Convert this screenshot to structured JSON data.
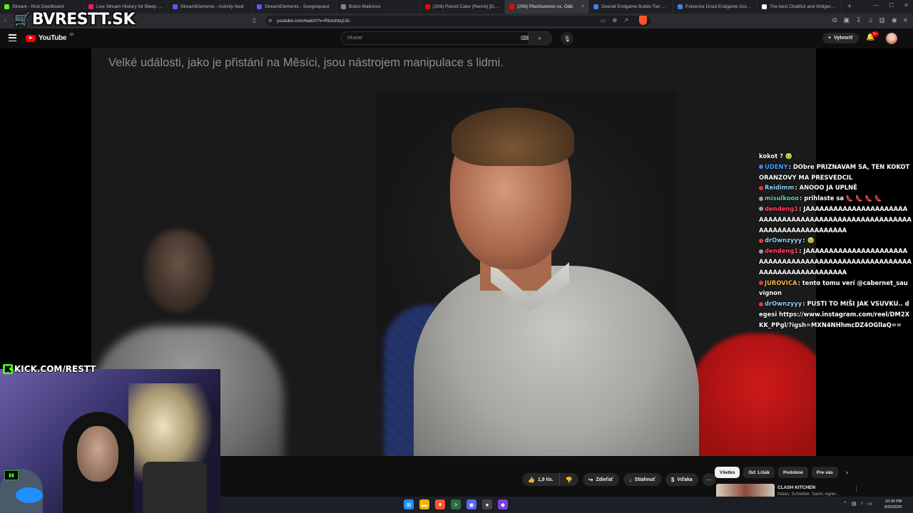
{
  "browser": {
    "tabs": [
      {
        "title": "Stream - Kick Dashboard",
        "color": "#53fc18"
      },
      {
        "title": "Live Stream History for Bleep Sharni",
        "color": "#e91e63"
      },
      {
        "title": "StreamElements - Activity feed",
        "color": "#5a5af5"
      },
      {
        "title": "StreamElements - Songrequest",
        "color": "#5a5af5"
      },
      {
        "title": "Bistro Malinovo",
        "color": "#888888"
      },
      {
        "title": "(206) Pound Cake (Remix) [Drake",
        "color": "#ff0000"
      },
      {
        "title": "(206) Plochozemci vs. Odb",
        "color": "#ff0000",
        "active": true
      },
      {
        "title": "Overall Endgame Builds Tier List",
        "color": "#3b82f6"
      },
      {
        "title": "Pulverize Druid Endgame Guide D",
        "color": "#3b82f6"
      },
      {
        "title": "The best ChatBot and Widgets fo",
        "color": "#ffffff"
      }
    ],
    "url": "youtube.com/watch?v=Rbzefdxj13s"
  },
  "overlay": {
    "brand_logo": "BVRESTT.SK",
    "kick_logo": "KICK.COM/RESTT"
  },
  "youtube": {
    "logo": "YouTube",
    "region": "SK",
    "search_placeholder": "Hľadať",
    "create_label": "Vytvoriť",
    "notifications_badge": "9+"
  },
  "video": {
    "subtitle": "Velké události, jako je přistání na Měsíci, jsou nástrojem manipulace s lidmi."
  },
  "chat": {
    "messages": [
      {
        "user": "",
        "badge_color": "",
        "user_color": "#ffffff",
        "text": "kokot ? 🤢"
      },
      {
        "user": "UDENY",
        "badge_color": "#3b82f6",
        "user_color": "#4da3ff",
        "text": "DObre PRIZNAVAM SA, TEN KOKOT ORANZOVY MA PRESVEDCIL"
      },
      {
        "user": "Reidimm",
        "badge_color": "#e53935",
        "user_color": "#8fd3ff",
        "text": "ANOOO JA UPLNĚ"
      },
      {
        "user": "misulkooo",
        "badge_color": "#9e9e9e",
        "user_color": "#66d9a0",
        "text": "prihlaste sa 👠 👠 👠 👠"
      },
      {
        "user": "dendeng1",
        "badge_color": "#9e9e9e",
        "user_color": "#ff4d6d",
        "text": "JAAAAAAAAAAAAAAAAAAAAAAAAAAAAAAAAAAAAAAAAAAAAAAAAAAAAAAAAAAAAAAAAAAAAAAAAAA"
      },
      {
        "user": "drOwnzyyy",
        "badge_color": "#e53935",
        "user_color": "#8fd3ff",
        "text": "🤢"
      },
      {
        "user": "dendeng1",
        "badge_color": "#9e9e9e",
        "user_color": "#ff4d6d",
        "text": "JAAAAAAAAAAAAAAAAAAAAAAAAAAAAAAAAAAAAAAAAAAAAAAAAAAAAAAAAAAAAAAAAAAAAAAAAAA"
      },
      {
        "user": "JUROVICA",
        "badge_color": "#e53935",
        "user_color": "#ffb74d",
        "text": "tento tomu verí @cabernet_sauvignon"
      },
      {
        "user": "drOwnzyyy",
        "badge_color": "#e53935",
        "user_color": "#8fd3ff",
        "text": "PUSTI TO MIŠI JAK VSUVKU.. degesi https://www.instagram.com/reel/DM2XKK_PPgl/?igsh=MXN4NHhmcDZ4OGllaQ=="
      }
    ]
  },
  "actions": {
    "like_count": "1,9 tis.",
    "share": "Zdieľať",
    "download": "Stiahnuť",
    "thanks": "Vďaka"
  },
  "chips": [
    "Všetko",
    "Od: Lišák",
    "Podobné",
    "Pre vás"
  ],
  "recommended": {
    "title": "CLASH KITCHEN",
    "subtitle": "Natan, Schreiber, Samir, Agnie..."
  },
  "taskbar": {
    "time": "10:34 PM",
    "date": "9/25/2025"
  }
}
